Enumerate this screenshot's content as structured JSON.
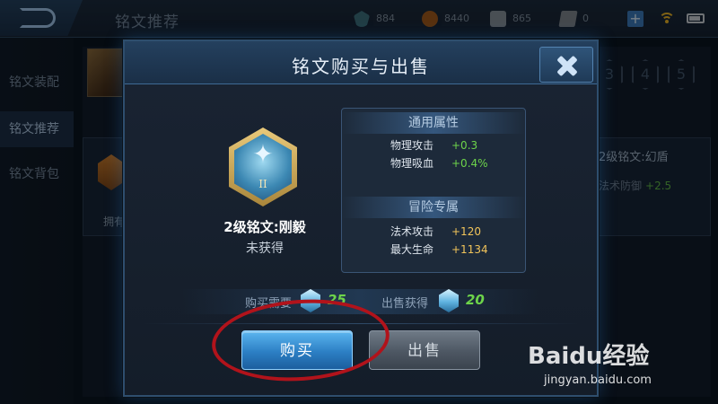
{
  "topbar": {
    "title": "铭文推荐",
    "currencies": [
      {
        "icon": "diamond-icon",
        "value": "884"
      },
      {
        "icon": "gold-coin-icon",
        "value": "8440"
      },
      {
        "icon": "ticket-icon",
        "value": "865"
      },
      {
        "icon": "card-icon",
        "value": "0"
      }
    ],
    "plus": "+"
  },
  "sidebar": {
    "items": [
      {
        "label": "铭文装配"
      },
      {
        "label": "铭文推荐"
      },
      {
        "label": "铭文背包"
      }
    ]
  },
  "background": {
    "slots": [
      "3",
      "4",
      "5"
    ],
    "left_card_label": "拥有",
    "right_card_name": "2级铭文:幻盾",
    "right_card_stat": "法术防御",
    "right_card_stat_value": "+2.5"
  },
  "dialog": {
    "title": "铭文购买与出售",
    "rune": {
      "level_numeral": "II",
      "name": "2级铭文:刚毅",
      "status": "未获得"
    },
    "general_attrs": {
      "header": "通用属性",
      "rows": [
        {
          "label": "物理攻击",
          "value": "+0.3"
        },
        {
          "label": "物理吸血",
          "value": "+0.4%"
        }
      ]
    },
    "adventure_attrs": {
      "header": "冒险专属",
      "rows": [
        {
          "label": "法术攻击",
          "value": "+120"
        },
        {
          "label": "最大生命",
          "value": "+1134"
        }
      ]
    },
    "buy_cost_label": "购买需要",
    "buy_cost_value": "25",
    "sell_gain_label": "出售获得",
    "sell_gain_value": "20",
    "buy_button": "购买",
    "sell_button": "出售"
  },
  "watermark": {
    "logo": "Baidu经验",
    "url": "jingyan.baidu.com"
  },
  "colors": {
    "accent_blue": "#2c7fc4",
    "green_value": "#6dd44a",
    "gold_value": "#f1c45a",
    "highlight_ellipse": "#b1131b"
  }
}
